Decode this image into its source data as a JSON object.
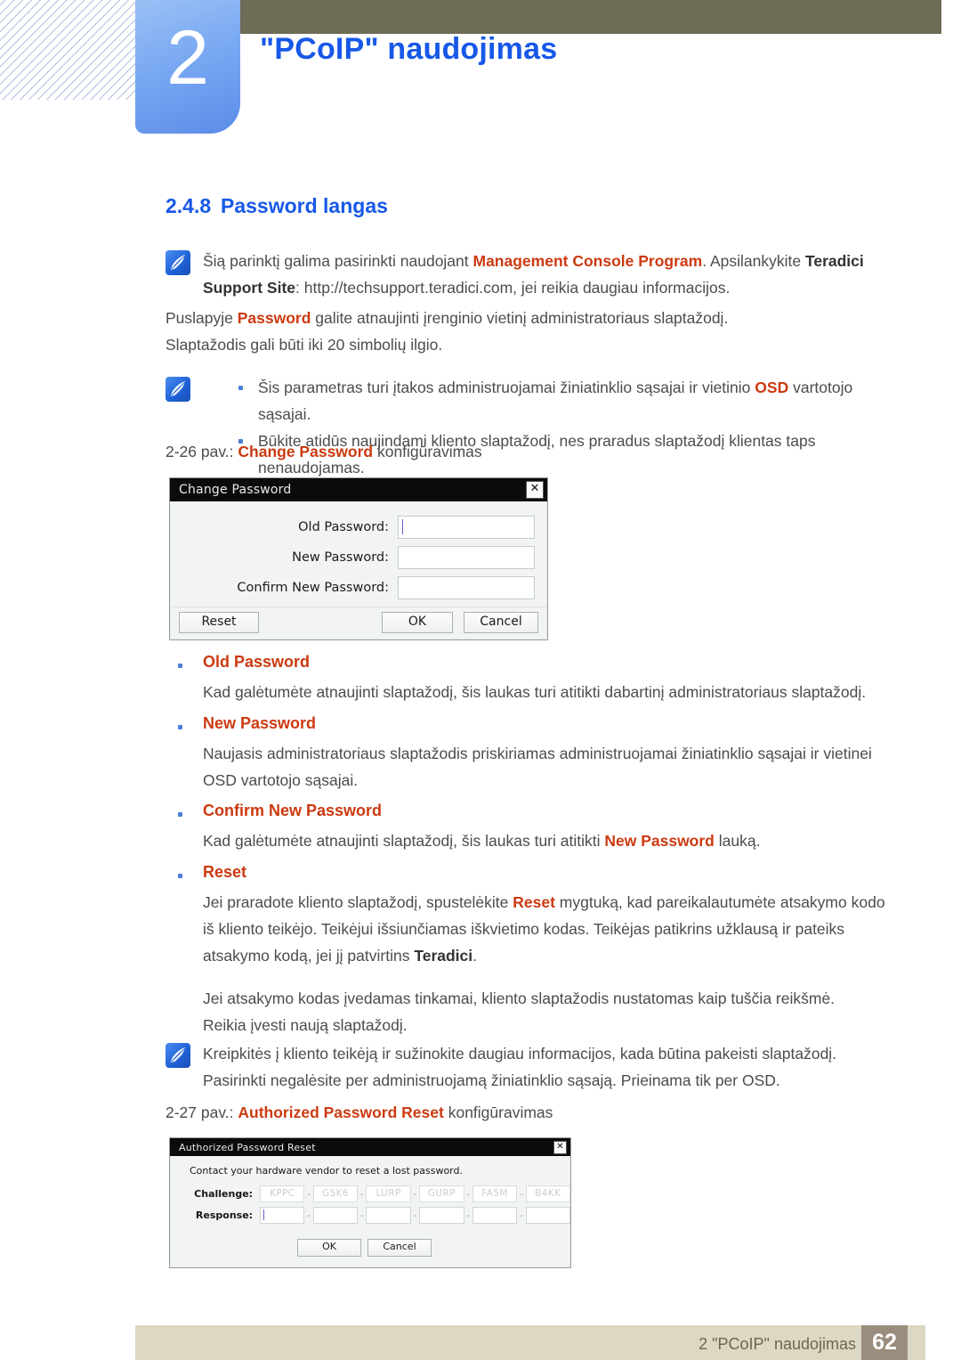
{
  "chapter": {
    "number": "2",
    "title": "\"PCoIP\" naudojimas"
  },
  "section": {
    "number": "2.4.8",
    "title": "Password langas"
  },
  "note_top": {
    "icon": "note-quill-icon",
    "line1_a": "Šią parinktį galima pasirinkti naudojant ",
    "line1_b": "Management Console Program",
    "line1_c": ". Apsilankykite ",
    "line1_d": "Teradici",
    "line2_a": "Support Site",
    "line2_b": ": http://techsupport.teradici.com, jei reikia daugiau informacijos."
  },
  "intro": {
    "p1_a": "Puslapyje ",
    "p1_b": "Password",
    "p1_c": " galite atnaujinti įrenginio vietinį administratoriaus slaptažodį.",
    "p2": "Slaptažodis gali būti iki 20 simbolių ilgio."
  },
  "note_bullets": {
    "icon": "note-quill-icon",
    "item1_a": "Šis parametras turi įtakos administruojamai žiniatinklio sąsajai ir vietinio ",
    "item1_b": "OSD",
    "item1_c": " vartotojo sąsajai.",
    "item2": "Būkite atidūs naujindami kliento slaptažodį, nes praradus slaptažodį klientas taps nenaudojamas."
  },
  "caption_1": {
    "prefix": "2-26 pav.: ",
    "highlight": "Change Password",
    "suffix": " konfigūravimas"
  },
  "dialog_change_password": {
    "title": "Change Password",
    "close_icon": "close-icon",
    "fields": [
      {
        "label": "Old Password:",
        "value": "",
        "focused": true
      },
      {
        "label": "New Password:",
        "value": "",
        "focused": false
      },
      {
        "label": "Confirm New Password:",
        "value": "",
        "focused": false
      }
    ],
    "buttons": {
      "reset": "Reset",
      "ok": "OK",
      "cancel": "Cancel"
    }
  },
  "terms": [
    {
      "label": "Old Password",
      "paragraphs": [
        "Kad galėtumėte atnaujinti slaptažodį, šis laukas turi atitikti dabartinį administratoriaus slaptažodį."
      ]
    },
    {
      "label": "New Password",
      "paragraphs": [
        "Naujasis administratoriaus slaptažodis priskiriamas administruojamai žiniatinklio sąsajai ir vietinei",
        "OSD vartotojo sąsajai."
      ]
    },
    {
      "label": "Confirm New Password",
      "paragraphs": [
        "Kad galėtumėte atnaujinti slaptažodį, šis laukas turi atitikti New Password lauką."
      ]
    },
    {
      "label": "Reset",
      "paragraphs": []
    }
  ],
  "confirm_text": {
    "a": "Kad galėtumėte atnaujinti slaptažodį, šis laukas turi atitikti ",
    "b": "New Password",
    "c": " lauką."
  },
  "reset_text": {
    "l1_a": "Jei praradote kliento slaptažodį, spustelėkite ",
    "l1_b": "Reset",
    "l1_c": " mygtuką, kad pareikalautumėte atsakymo kodo",
    "l2": "iš kliento teikėjo. Teikėjui išsiunčiamas iškvietimo kodas. Teikėjas patikrins užklausą ir pateiks",
    "l3_a": "atsakymo kodą, jei jį patvirtins ",
    "l3_b": "Teradici",
    "l3_c": ".",
    "l4": "Jei atsakymo kodas įvedamas tinkamai, kliento slaptažodis nustatomas kaip tuščia reikšmė.",
    "l5": "Reikia įvesti naują slaptažodį."
  },
  "note_bottom": {
    "icon": "note-quill-icon",
    "line1": "Kreipkitės į kliento teikėją ir sužinokite daugiau informacijos, kada būtina pakeisti slaptažodį.",
    "line2": "Pasirinkti negalėsite per administruojamą žiniatinklio sąsają. Prieinama tik per OSD."
  },
  "caption_2": {
    "prefix": "2-27 pav.: ",
    "highlight": "Authorized Password Reset",
    "suffix": " konfigūravimas"
  },
  "dialog_authorized_reset": {
    "title": "Authorized Password Reset",
    "close_icon": "close-icon",
    "instruction": "Contact your hardware vendor to reset a lost password.",
    "challenge_label": "Challenge:",
    "response_label": "Response:",
    "challenge_codes": [
      "KPPC",
      "G5K6",
      "LURP",
      "GURP",
      "FA5M",
      "B4KK"
    ],
    "response_values": [
      "",
      "",
      "",
      "",
      "",
      ""
    ],
    "separator": "-",
    "buttons": {
      "ok": "OK",
      "cancel": "Cancel"
    }
  },
  "footer": {
    "text": "2 \"PCoIP\" naudojimas",
    "page": "62"
  },
  "colors": {
    "heading_blue": "#1758e8",
    "accent_orange": "#cc3a11",
    "olive_bar": "#6e6b56",
    "tab_blue": "#79a9f2",
    "footer_bar": "#ddd8c4",
    "footer_page_box": "#9b8d7e",
    "body_text": "#4c4c4c"
  }
}
